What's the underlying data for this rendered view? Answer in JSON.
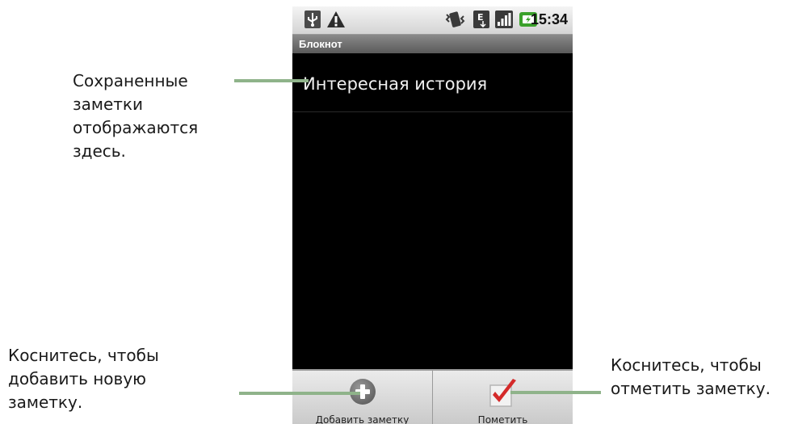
{
  "status_bar": {
    "time": "15:34",
    "icons": [
      "usb-debug-icon",
      "warning-icon",
      "vibrate-icon",
      "data-edge-icon",
      "signal-icon",
      "battery-charging-icon"
    ]
  },
  "app": {
    "title": "Блокнот",
    "notes": [
      {
        "title": "Интересная история"
      }
    ]
  },
  "menu": {
    "add_label": "Добавить заметку",
    "mark_label": "Пометить"
  },
  "callouts": {
    "notes": [
      "Сохраненные",
      "заметки",
      "отображаются",
      "здесь."
    ],
    "add": [
      "Коснитесь, чтобы",
      "добавить новую",
      "заметку."
    ],
    "mark": [
      "Коснитесь, чтобы",
      "отметить заметку."
    ]
  },
  "colors": {
    "leader": "#8fb38a",
    "screen_bg": "#000000",
    "check_red": "#d42a2a"
  }
}
